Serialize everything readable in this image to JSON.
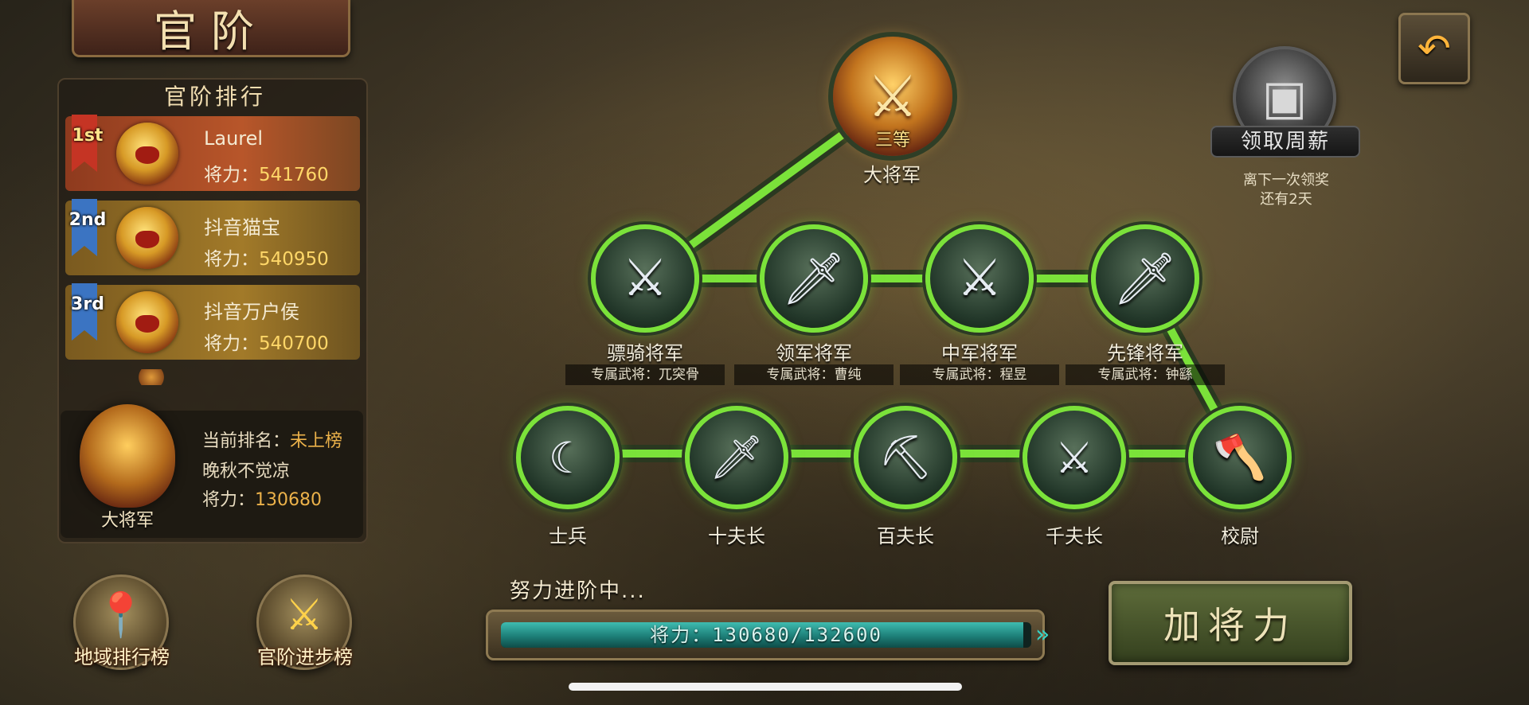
{
  "title": "官阶",
  "ranking": {
    "header": "官阶排行",
    "entries": [
      {
        "rank": "1st",
        "name": "Laurel",
        "power_label": "将力：",
        "power": "541760"
      },
      {
        "rank": "2nd",
        "name": "抖音猫宝",
        "power_label": "将力：",
        "power": "540950"
      },
      {
        "rank": "3rd",
        "name": "抖音万户侯",
        "power_label": "将力：",
        "power": "540700"
      }
    ]
  },
  "me": {
    "emblem_label": "大将军",
    "rank_label": "当前排名：",
    "rank_value": "未上榜",
    "name": "晚秋不觉凉",
    "power_label": "将力：",
    "power": "130680"
  },
  "buttons": {
    "region_rank": "地域排行榜",
    "advance_rank": "官阶进步榜",
    "add_power": "加将力"
  },
  "tree": {
    "top": {
      "tier": "三等",
      "label": "大将军",
      "icon": "gold-crossed-axes-emblem"
    },
    "middle": [
      {
        "label": "骠骑将军",
        "sub_label": "专属武将：",
        "sub_value": "兀突骨",
        "icon": "crossed-swords-icon"
      },
      {
        "label": "领军将军",
        "sub_label": "专属武将：",
        "sub_value": "曹纯",
        "icon": "three-swords-icon"
      },
      {
        "label": "中军将军",
        "sub_label": "专属武将：",
        "sub_value": "程昱",
        "icon": "crossed-swords-icon"
      },
      {
        "label": "先锋将军",
        "sub_label": "专属武将：",
        "sub_value": "钟繇",
        "icon": "single-sword-icon"
      }
    ],
    "bottom": [
      {
        "label": "士兵",
        "icon": "sickle-icon"
      },
      {
        "label": "十夫长",
        "icon": "dagger-icon"
      },
      {
        "label": "百夫长",
        "icon": "pickaxe-icon"
      },
      {
        "label": "千夫长",
        "icon": "broadsword-icon"
      },
      {
        "label": "校尉",
        "icon": "glaive-icon"
      }
    ]
  },
  "weekly": {
    "label": "领取周薪",
    "note_line1": "离下一次领奖",
    "note_line2": "还有2天",
    "icon": "treasure-chest-icon"
  },
  "progress": {
    "caption": "努力进阶中...",
    "label": "将力：",
    "current": 130680,
    "target": 132600,
    "text": "130680/132600"
  },
  "colors": {
    "path_green": "#7be23a",
    "gold": "#ffd768",
    "progress_teal": "#3fbcb0"
  }
}
